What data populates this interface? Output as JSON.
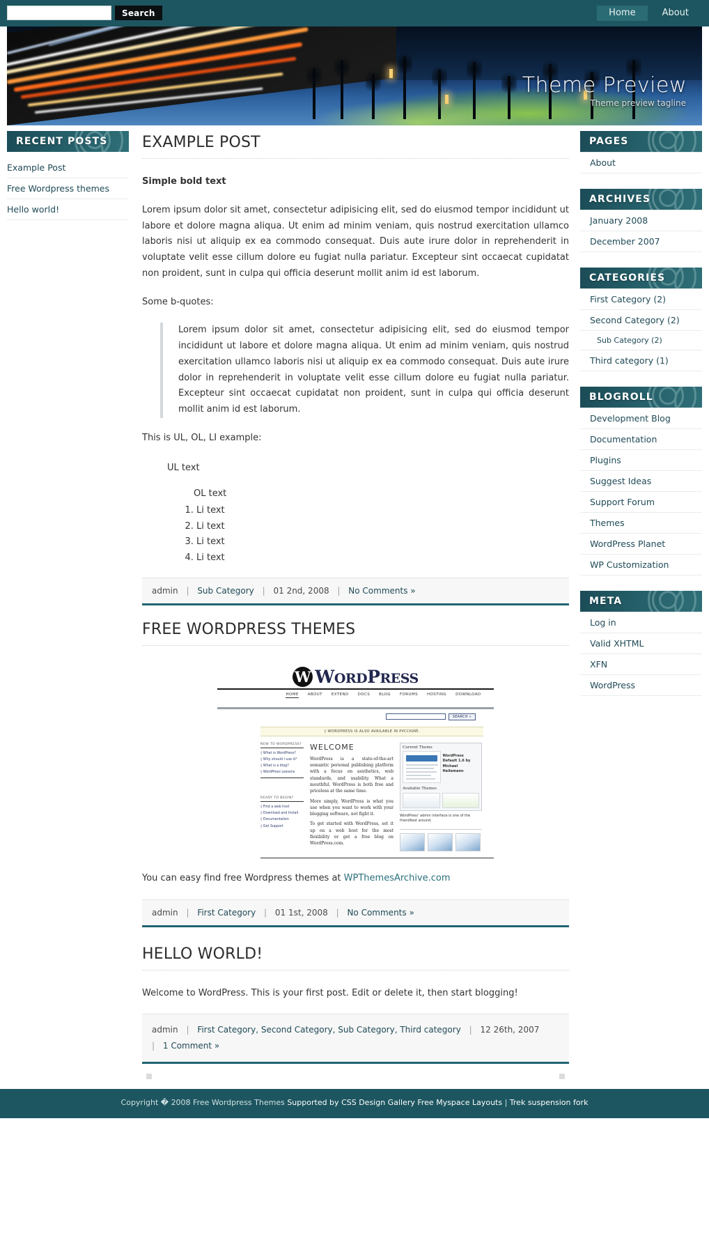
{
  "topbar": {
    "search_placeholder": "",
    "search_value": "",
    "search_button": "Search",
    "nav": [
      {
        "label": "Home",
        "active": true
      },
      {
        "label": "About",
        "active": false
      }
    ]
  },
  "header": {
    "title": "Theme Preview",
    "tagline": "Theme preview tagline"
  },
  "left_sidebar": {
    "widgets": [
      {
        "title": "RECENT POSTS",
        "items": [
          {
            "label": "Example Post"
          },
          {
            "label": "Free Wordpress themes"
          },
          {
            "label": "Hello world!"
          }
        ]
      }
    ]
  },
  "right_sidebar": {
    "widgets": [
      {
        "title": "PAGES",
        "items": [
          {
            "label": "About",
            "sub": false
          }
        ]
      },
      {
        "title": "ARCHIVES",
        "items": [
          {
            "label": "January 2008",
            "sub": false
          },
          {
            "label": "December 2007",
            "sub": false
          }
        ]
      },
      {
        "title": "CATEGORIES",
        "items": [
          {
            "label": "First Category (2)",
            "sub": false
          },
          {
            "label": "Second Category (2)",
            "sub": false
          },
          {
            "label": "Sub Category (2)",
            "sub": true
          },
          {
            "label": "Third category (1)",
            "sub": false
          }
        ]
      },
      {
        "title": "BLOGROLL",
        "items": [
          {
            "label": "Development Blog",
            "sub": false
          },
          {
            "label": "Documentation",
            "sub": false
          },
          {
            "label": "Plugins",
            "sub": false
          },
          {
            "label": "Suggest Ideas",
            "sub": false
          },
          {
            "label": "Support Forum",
            "sub": false
          },
          {
            "label": "Themes",
            "sub": false
          },
          {
            "label": "WordPress Planet",
            "sub": false
          },
          {
            "label": "WP Customization",
            "sub": false
          }
        ]
      },
      {
        "title": "META",
        "items": [
          {
            "label": "Log in",
            "sub": false
          },
          {
            "label": "Valid XHTML",
            "sub": false
          },
          {
            "label": "XFN",
            "sub": false
          },
          {
            "label": "WordPress",
            "sub": false
          }
        ]
      }
    ]
  },
  "posts": [
    {
      "title": "EXAMPLE POST",
      "bold_intro": "Simple bold text",
      "paragraph1": "Lorem ipsum dolor sit amet, consectetur adipisicing elit, sed do eiusmod tempor incididunt ut labore et dolore magna aliqua. Ut enim ad minim veniam, quis nostrud exercitation ullamco laboris nisi ut aliquip ex ea commodo consequat. Duis aute irure dolor in reprehenderit in voluptate velit esse cillum dolore eu fugiat nulla pariatur. Excepteur sint occaecat cupidatat non proident, sunt in culpa qui officia deserunt mollit anim id est laborum.",
      "quote_intro": "Some b-quotes:",
      "blockquote": "Lorem ipsum dolor sit amet, consectetur adipisicing elit, sed do eiusmod tempor incididunt ut labore et dolore magna aliqua. Ut enim ad minim veniam, quis nostrud exercitation ullamco laboris nisi ut aliquip ex ea commodo consequat. Duis aute irure dolor in reprehenderit in voluptate velit esse cillum dolore eu fugiat nulla pariatur. Excepteur sint occaecat cupidatat non proident, sunt in culpa qui officia deserunt mollit anim id est laborum.",
      "list_intro": "This is UL, OL, LI example:",
      "ul_item": "UL text",
      "ol_head": "OL text",
      "ol_items": [
        "Li text",
        "Li text",
        "Li text",
        "Li text"
      ],
      "meta": {
        "author": "admin",
        "category": "Sub Category",
        "date": "01 2nd, 2008",
        "comments": "No Comments »"
      }
    },
    {
      "title": "FREE WORDPRESS THEMES",
      "caption_before": "You can easy find free Wordpress themes at ",
      "caption_link": "WPThemesArchive.com",
      "meta": {
        "author": "admin",
        "category": "First Category",
        "date": "01 1st, 2008",
        "comments": "No Comments »"
      }
    },
    {
      "title": "HELLO WORLD!",
      "paragraph1": "Welcome to WordPress. This is your first post. Edit or delete it, then start blogging!",
      "meta": {
        "author": "admin",
        "category": "First Category, Second Category, Sub Category, Third category",
        "date": "12 26th, 2007",
        "comments": "1 Comment »"
      }
    }
  ],
  "wp_screenshot": {
    "wordmark_w": "W",
    "wordmark_rest": "ORD",
    "wordmark_p": "P",
    "wordmark_ress": "RESS",
    "nav": [
      "HOME",
      "ABOUT",
      "EXTEND",
      "DOCS",
      "BLOG",
      "FORUMS",
      "HOSTING",
      "DOWNLOAD"
    ],
    "search_button": "SEARCH »",
    "notice": "◊ WORDPRESS IS ALSO AVAILABLE IN РУССКИЙ.",
    "welcome": "WELCOME",
    "left_heading": "NEW TO WORDPRESS?",
    "left_links": [
      "◊ What is WordPress?",
      "◊ Why should I use it?",
      "◊ What is a blog?",
      "◊ WordPress Lessons"
    ],
    "left_heading2": "READY TO BEGIN?",
    "left_links2": [
      "◊ Find a web host",
      "◊ Download and Install",
      "◊ Documentation",
      "◊ Get Support"
    ],
    "para1": "WordPress is a state-of-the-art semantic personal publishing platform with a focus on aesthetics, web standards, and usability. What a mouthful. WordPress is both free and priceless at the same time.",
    "para2": "More simply, WordPress is what you use when you want to work with your blogging software, not fight it.",
    "para3": "To get started with WordPress, set it up on a web host for the most flexibility or get a free blog on WordPress.com.",
    "panel_title": "Current Theme",
    "panel_caption": "WordPress Default 1.6 by Michael Heilemann",
    "available_themes": "Available Themes",
    "admin_caption": "WordPress' admin interface is one of the friendliest around."
  },
  "footer": {
    "copyright": "Copyright",
    "symbol": "�",
    "year_text": "2008 Free Wordpress Themes",
    "supported": "Supported by",
    "link1": "CSS Design Gallery",
    "link2": "Free Myspace Layouts",
    "sep": " | ",
    "link3": "Trek suspension fork"
  },
  "colors": {
    "teal": "#1d5660",
    "teal_dark": "#1b4c57",
    "link": "#1f4a56",
    "meta_border": "#1f6470"
  }
}
